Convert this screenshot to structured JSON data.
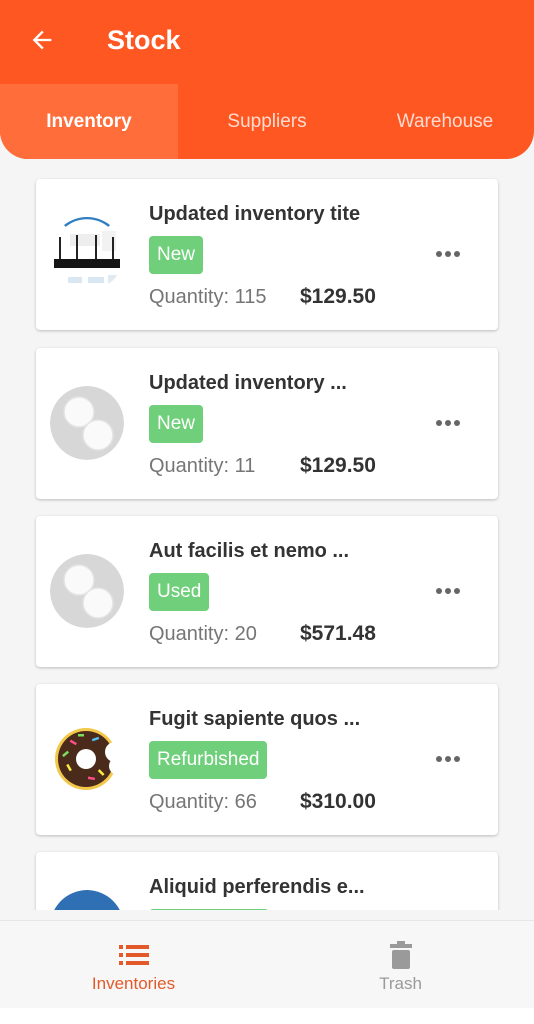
{
  "header": {
    "title": "Stock",
    "accent_color": "#ff5722",
    "back_icon": "arrow-left-icon"
  },
  "tabs": [
    {
      "label": "Inventory",
      "active": true
    },
    {
      "label": "Suppliers",
      "active": false
    },
    {
      "label": "Warehouse",
      "active": false
    }
  ],
  "items": [
    {
      "name": "Updated inventory tite",
      "condition": "New",
      "quantity": "Quantity: 115",
      "price": "$129.50",
      "thumbnail": "router-product-icon"
    },
    {
      "name": "Updated inventory ...",
      "condition": "New",
      "quantity": "Quantity: 11",
      "price": "$129.50",
      "thumbnail": "cotton-pads-icon"
    },
    {
      "name": "Aut facilis et nemo ...",
      "condition": "Used",
      "quantity": "Quantity: 20",
      "price": "$571.48",
      "thumbnail": "cotton-pads-icon"
    },
    {
      "name": "Fugit sapiente quos ...",
      "condition": "Refurbished",
      "quantity": "Quantity: 66",
      "price": "$310.00",
      "thumbnail": "donut-icon"
    },
    {
      "name": "Aliquid perferendis e...",
      "condition": "",
      "quantity": "",
      "price": "",
      "thumbnail": "product-icon"
    }
  ],
  "badge_color": "#6fcf7a",
  "more_icon": "more-horizontal-icon",
  "bottom_nav": {
    "inventories": {
      "label": "Inventories",
      "icon": "list-icon",
      "active": true
    },
    "trash": {
      "label": "Trash",
      "icon": "trash-icon",
      "active": false
    }
  }
}
